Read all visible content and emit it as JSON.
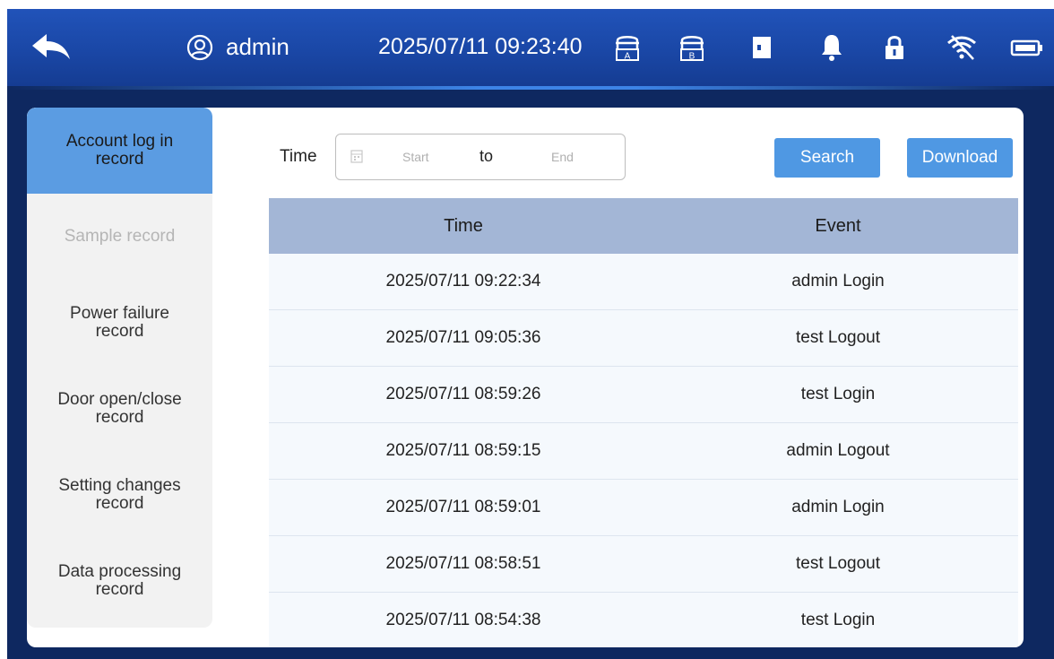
{
  "header": {
    "username": "admin",
    "datetime": "2025/07/11 09:23:40",
    "icons": [
      "back-arrow-icon",
      "user-icon",
      "chamber-a-icon",
      "chamber-b-icon",
      "door-icon",
      "bell-icon",
      "lock-icon",
      "wifi-icon",
      "battery-icon"
    ],
    "chamber_a_letter": "A",
    "chamber_b_letter": "B"
  },
  "sidebar": {
    "items": [
      {
        "label": "Account log in\nrecord",
        "state": "active"
      },
      {
        "label": "Sample record",
        "state": "disabled"
      },
      {
        "label": "Power failure\nrecord",
        "state": "normal"
      },
      {
        "label": "Door open/close\nrecord",
        "state": "normal"
      },
      {
        "label": "Setting changes\nrecord",
        "state": "normal"
      },
      {
        "label": "Data processing\nrecord",
        "state": "normal"
      }
    ]
  },
  "filter": {
    "label": "Time",
    "start_placeholder": "Start",
    "to_label": "to",
    "end_placeholder": "End",
    "search_label": "Search",
    "download_label": "Download"
  },
  "table": {
    "columns": [
      "Time",
      "Event"
    ],
    "rows": [
      [
        "2025/07/11 09:22:34",
        "admin Login"
      ],
      [
        "2025/07/11 09:05:36",
        "test Logout"
      ],
      [
        "2025/07/11 08:59:26",
        "test Login"
      ],
      [
        "2025/07/11 08:59:15",
        "admin Logout"
      ],
      [
        "2025/07/11 08:59:01",
        "admin Login"
      ],
      [
        "2025/07/11 08:58:51",
        "test Logout"
      ],
      [
        "2025/07/11 08:54:38",
        "test Login"
      ]
    ]
  },
  "colors": {
    "topbar": "#1a47a6",
    "accent": "#5b9ce2",
    "button": "#4f98e3",
    "table_header": "#a3b6d6"
  }
}
